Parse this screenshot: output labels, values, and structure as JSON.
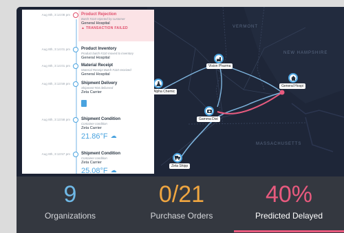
{
  "colors": {
    "accent_blue": "#4aa3df",
    "alert": "#e04e6b",
    "orders": "#f0a640",
    "delayed": "#e85a7e",
    "map_bg": "#1b2233"
  },
  "map": {
    "region_labels": [
      "VERMONT",
      "NEW HAMPSHIRE",
      "MASSACHUSETTS"
    ],
    "pins": [
      {
        "label": "Vision Pharma",
        "icon": "factory-icon"
      },
      {
        "label": "General Hospi",
        "icon": "home-icon"
      },
      {
        "label": "Gamma Dist",
        "icon": "camera-icon"
      },
      {
        "label": "Alpha Chemic",
        "icon": "flask-icon"
      },
      {
        "label": "Zeta Shipp",
        "icon": "truck-icon"
      }
    ]
  },
  "timeline": [
    {
      "time": "Aug 8th, 3:14:08 pm",
      "title": "Product Rejection",
      "sub": "Batch #110 rejected by customer",
      "party": "General Hospital",
      "status": "TRANSACTION FAILED"
    },
    {
      "time": "Aug 8th, 3:14:01 pm",
      "title": "Product Inventory",
      "sub": "Product batch #110 moved to inventory",
      "party": "General Hospital"
    },
    {
      "time": "Aug 8th, 3:14:01 pm",
      "title": "Material Receipt",
      "sub": "Material Receipt Batch #110 received",
      "party": "General Hospital"
    },
    {
      "time": "Aug 8th, 3:13:59 pm",
      "title": "Shipment Delivery",
      "sub": "Shipment #04 delivered",
      "party": "Zeta Carrier"
    },
    {
      "time": "Aug 8th, 3:13:58 pm",
      "title": "Shipment Condition",
      "sub": "Container condition",
      "party": "Zeta Carrier",
      "reading": "21.86°F"
    },
    {
      "time": "Aug 8th, 3:13:57 pm",
      "title": "Shipment Condition",
      "sub": "Container condition",
      "party": "Zeta Carrier",
      "reading": "25.08°F"
    }
  ],
  "stats": [
    {
      "value": "9",
      "label": "Organizations"
    },
    {
      "value": "0/21",
      "label": "Purchase Orders"
    },
    {
      "value": "40%",
      "label": "Predicted Delayed"
    }
  ]
}
